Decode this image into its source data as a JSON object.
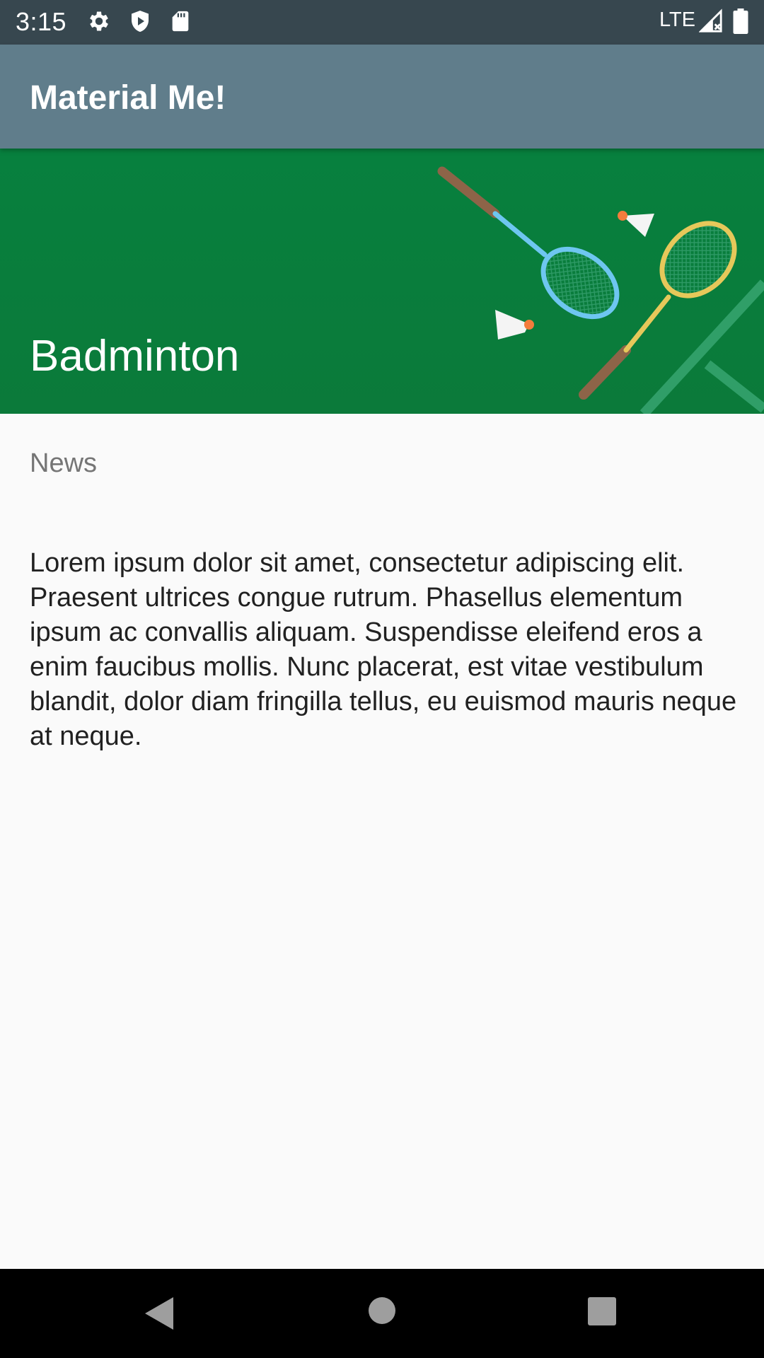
{
  "status_bar": {
    "time": "3:15",
    "network": "LTE",
    "icons": [
      "gear-icon",
      "shield-play-icon",
      "sd-card-icon",
      "signal-icon",
      "battery-icon"
    ]
  },
  "app_bar": {
    "title": "Material Me!",
    "color": "#607d8b"
  },
  "detail": {
    "title": "Badminton",
    "subtitle": "News",
    "body": "Lorem ipsum dolor sit amet, consectetur adipiscing elit. Praesent ultrices congue rutrum. Phasellus elementum ipsum ac convallis aliquam. Suspendisse eleifend eros a enim faucibus mollis. Nunc placerat, est vitae vestibulum blandit, dolor diam fringilla tellus, eu euismod mauris neque at neque.",
    "image": "badminton-rackets-illustration"
  },
  "nav_bar": {
    "buttons": [
      "back-icon",
      "home-icon",
      "recents-icon"
    ]
  }
}
